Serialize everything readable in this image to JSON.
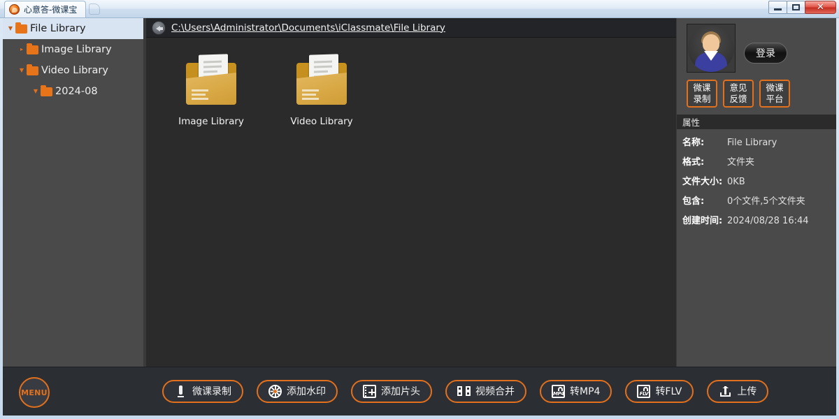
{
  "window": {
    "title": "心意答-微课宝",
    "app_icon": "app-logo-icon",
    "minimize_label": "",
    "maximize_label": "",
    "close_label": "✕"
  },
  "sidebar": {
    "items": [
      {
        "label": "File Library",
        "twisty": "▼",
        "indent": 0,
        "selected": true
      },
      {
        "label": "Image Library",
        "twisty": "▸",
        "indent": 1,
        "selected": false
      },
      {
        "label": "Video Library",
        "twisty": "▼",
        "indent": 1,
        "selected": false
      },
      {
        "label": "2024-08",
        "twisty": "▼",
        "indent": 2,
        "selected": false
      }
    ]
  },
  "pathbar": {
    "back_icon": "back-arrow-icon",
    "path": "C:\\Users\\Administrator\\Documents\\iClassmate\\File Library"
  },
  "files": [
    {
      "label": "Image Library",
      "icon": "folder-document-icon"
    },
    {
      "label": "Video Library",
      "icon": "folder-document-icon"
    }
  ],
  "account": {
    "avatar_icon": "user-avatar-icon",
    "login_label": "登录",
    "buttons": [
      {
        "line1": "微课",
        "line2": "录制"
      },
      {
        "line1": "意见",
        "line2": "反馈"
      },
      {
        "line1": "微课",
        "line2": "平台"
      }
    ]
  },
  "properties": {
    "header": "属性",
    "rows": [
      {
        "key": "名称:",
        "value": "File Library"
      },
      {
        "key": "格式:",
        "value": "文件夹"
      },
      {
        "key": "文件大小:",
        "value": "0KB"
      },
      {
        "key": "包含:",
        "value": "0个文件,5个文件夹"
      },
      {
        "key": "创建时间:",
        "value": "2024/08/28  16:44"
      }
    ]
  },
  "toolbar": {
    "menu_label": "MENU",
    "buttons": [
      {
        "label": "微课录制",
        "icon": "microphone-icon"
      },
      {
        "label": "添加水印",
        "icon": "watermark-wheel-icon"
      },
      {
        "label": "添加片头",
        "icon": "film-plus-icon"
      },
      {
        "label": "视频合并",
        "icon": "merge-panels-icon"
      },
      {
        "label": "转MP4",
        "icon": "mp4-convert-icon",
        "badge": "MP4"
      },
      {
        "label": "转FLV",
        "icon": "flv-convert-icon",
        "badge": "FLV"
      },
      {
        "label": "上传",
        "icon": "upload-icon"
      }
    ]
  },
  "colors": {
    "accent_orange": "#e2701c",
    "panel_gray": "#4a4a4a",
    "file_area": "#2b2b2b",
    "toolbar_bg": "#2b2e33",
    "selection_blue": "#d8e4f2",
    "folder_gold": "#d9a946"
  }
}
